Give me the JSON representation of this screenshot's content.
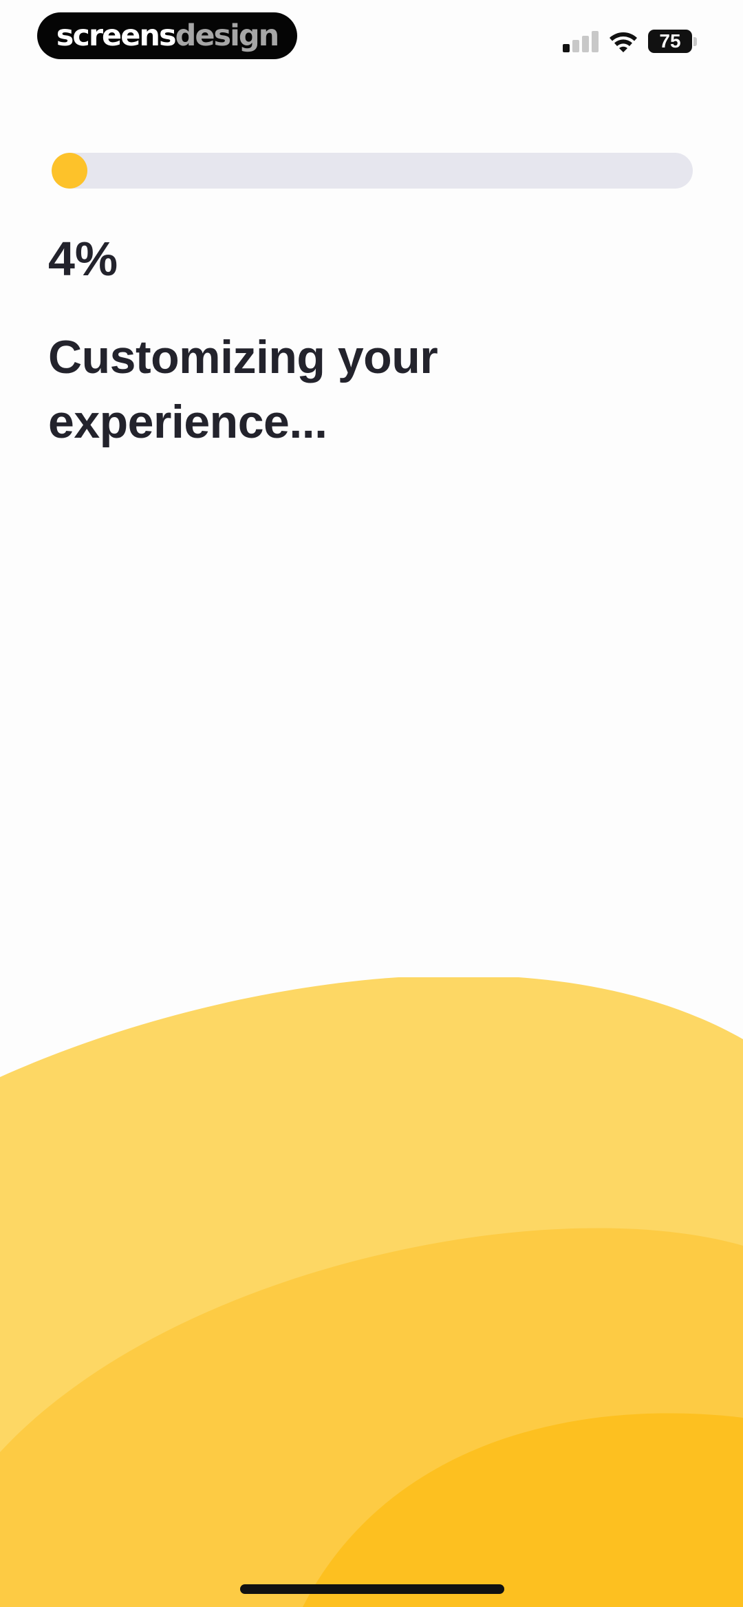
{
  "status_bar": {
    "logo_part1": "screens",
    "logo_part2": "design",
    "battery_level": "75",
    "signal_bars_active": 1,
    "signal_bars_total": 4
  },
  "progress": {
    "percent_value": 4,
    "percent_label": "4%",
    "headline": "Customizing your experience..."
  },
  "colors": {
    "accent": "#fdc22a",
    "track": "#e6e6ee",
    "text": "#23232c",
    "wave_light": "#fdd764",
    "wave_mid": "#fdcb44",
    "wave_deep": "#fdc020"
  },
  "icons": {
    "signal": "cellular-signal-icon",
    "wifi": "wifi-icon",
    "battery": "battery-icon"
  }
}
